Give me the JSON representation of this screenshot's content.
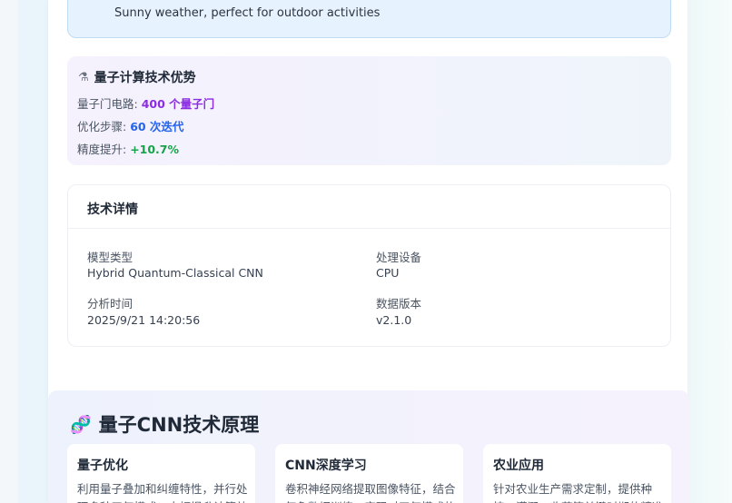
{
  "weather": {
    "text": "Sunny weather, perfect for outdoor activities"
  },
  "quantum": {
    "title": "量子计算技术优势",
    "icon": "microscope-icon",
    "rows": [
      {
        "label": "量子门电路: ",
        "value": "400 个量子门",
        "color": "#8b2be2"
      },
      {
        "label": "优化步骤: ",
        "value": "60 次迭代",
        "color": "#2563eb"
      },
      {
        "label": "精度提升: ",
        "value": "+10.7%",
        "color": "#16a34a"
      }
    ]
  },
  "details": {
    "title": "技术详情",
    "items": [
      {
        "label": "模型类型",
        "value": "Hybrid Quantum-Classical CNN"
      },
      {
        "label": "处理设备",
        "value": "CPU"
      },
      {
        "label": "分析时间",
        "value": "2025/9/21 14:20:56"
      },
      {
        "label": "数据版本",
        "value": "v2.1.0"
      }
    ]
  },
  "principle": {
    "title": "量子CNN技术原理",
    "icon": "dna-icon",
    "cards": [
      {
        "title": "量子优化",
        "desc": "利用量子叠加和纠缠特性，并行处理多种天气模式，大幅提升计算效"
      },
      {
        "title": "CNN深度学习",
        "desc": "卷积神经网络提取图像特征，结合气象数据训练，实现对天气模式的"
      },
      {
        "title": "农业应用",
        "desc": "针对农业生产需求定制，提供种植、灌溉、收获等关键时期的精准"
      }
    ]
  }
}
